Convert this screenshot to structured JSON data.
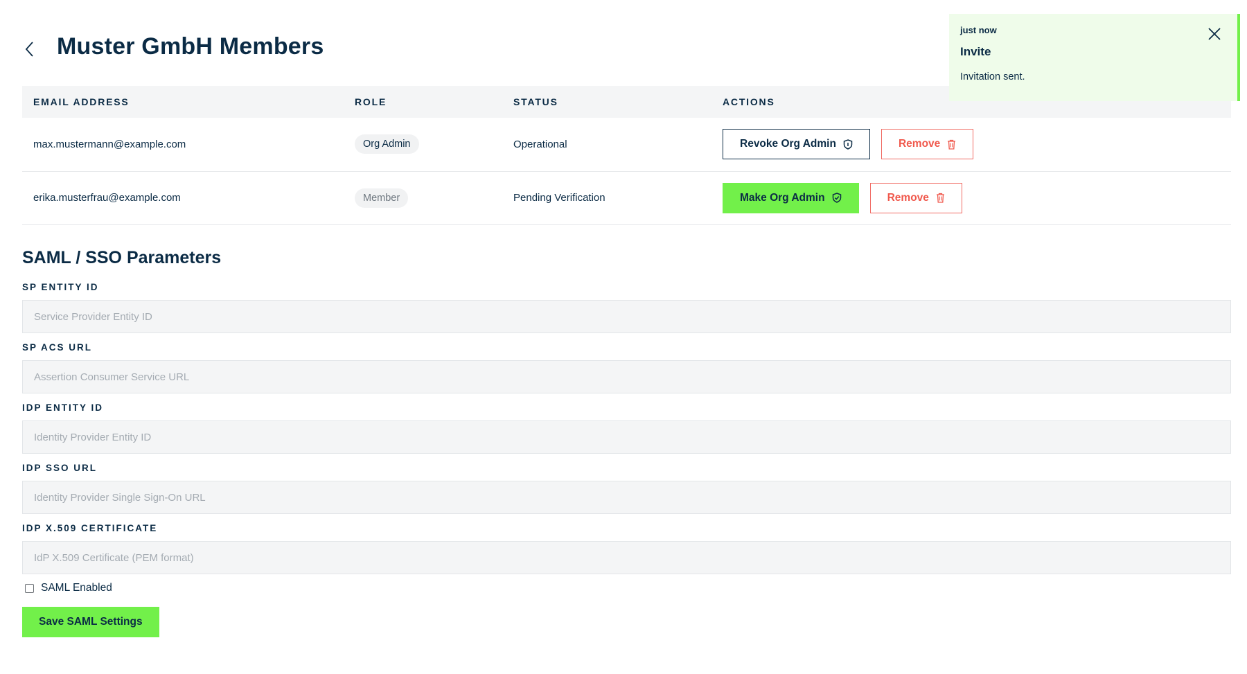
{
  "header": {
    "title": "Muster GmbH Members",
    "back_icon": "chevron-left-icon"
  },
  "members_table": {
    "columns": [
      "EMAIL ADDRESS",
      "ROLE",
      "STATUS",
      "ACTIONS"
    ],
    "rows": [
      {
        "email": "max.mustermann@example.com",
        "role": "Org Admin",
        "status": "Operational",
        "primary_action": "Revoke Org Admin",
        "remove_action": "Remove"
      },
      {
        "email": "erika.musterfrau@example.com",
        "role": "Member",
        "status": "Pending Verification",
        "primary_action": "Make Org Admin",
        "remove_action": "Remove"
      }
    ]
  },
  "saml": {
    "title": "SAML / SSO Parameters",
    "fields": [
      {
        "label": "SP ENTITY ID",
        "placeholder": "Service Provider Entity ID",
        "value": ""
      },
      {
        "label": "SP ACS URL",
        "placeholder": "Assertion Consumer Service URL",
        "value": ""
      },
      {
        "label": "IDP ENTITY ID",
        "placeholder": "Identity Provider Entity ID",
        "value": ""
      },
      {
        "label": "IDP SSO URL",
        "placeholder": "Identity Provider Single Sign-On URL",
        "value": ""
      },
      {
        "label": "IDP X.509 CERTIFICATE",
        "placeholder": "IdP X.509 Certificate (PEM format)",
        "value": ""
      }
    ],
    "enabled_label": "SAML Enabled",
    "enabled": false,
    "save_label": "Save SAML Settings"
  },
  "toast": {
    "time": "just now",
    "title": "Invite",
    "message": "Invitation sent."
  },
  "colors": {
    "primary": "#0b2b45",
    "accent_green": "#72f04a",
    "danger": "#f0584c",
    "toast_bg": "#effcea",
    "field_bg": "#f4f5f6"
  }
}
